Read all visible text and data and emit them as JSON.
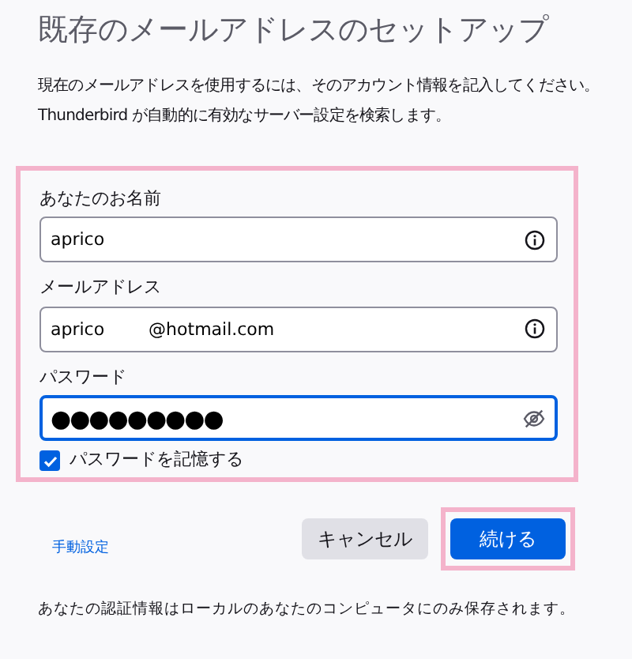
{
  "title": "既存のメールアドレスのセットアップ",
  "description": [
    "現在のメールアドレスを使用するには、そのアカウント情報を記入してください。",
    "Thunderbird が自動的に有効なサーバー設定を検索します。"
  ],
  "form": {
    "highlighted": true,
    "fields": [
      {
        "label": "あなたのお名前",
        "value": "aprico",
        "kind": "info",
        "focused": false
      },
      {
        "label": "メールアドレス",
        "value": "aprico        @hotmail.com",
        "kind": "info",
        "focused": false
      },
      {
        "label": "パスワード",
        "value": "●●●●●●●●●",
        "kind": "password",
        "focused": true
      }
    ],
    "remember_password": {
      "label": "パスワードを記憶する",
      "checked": true
    }
  },
  "manual_link": "手動設定",
  "buttons": [
    {
      "label": "キャンセル",
      "kind": "secondary",
      "highlighted": false
    },
    {
      "label": "続ける",
      "kind": "primary",
      "highlighted": true
    }
  ],
  "footer": "あなたの認証情報はローカルのあなたのコンピュータにのみ保存されます。"
}
